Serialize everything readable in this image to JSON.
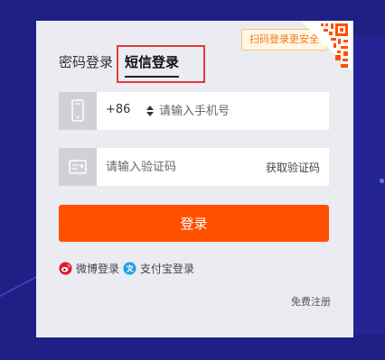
{
  "tabs": {
    "password_login": "密码登录",
    "sms_login": "短信登录"
  },
  "qr_tip": "扫码登录更安全",
  "phone": {
    "country_code": "+86",
    "placeholder": "请输入手机号",
    "value": ""
  },
  "verification": {
    "placeholder": "请输入验证码",
    "value": "",
    "get_code_label": "获取验证码"
  },
  "login_button": "登录",
  "third_party": {
    "weibo_label": "微博登录",
    "alipay_label": "支付宝登录"
  },
  "register_link": "免费注册",
  "colors": {
    "page_background": "#1f1f86",
    "panel_background": "#ebebf2",
    "accent_orange": "#ff5000",
    "highlight_red": "#e53935"
  },
  "icons": [
    "phone-icon",
    "id-card-icon",
    "qr-code-icon",
    "weibo-icon",
    "alipay-icon",
    "select-arrows-icon"
  ]
}
